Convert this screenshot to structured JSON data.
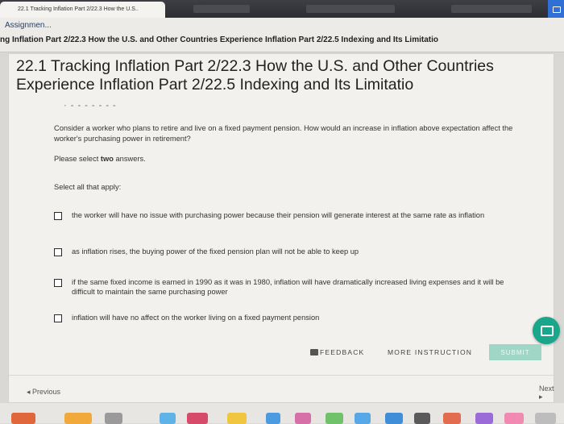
{
  "browser": {
    "tab_title": "22.1 Tracking Inflation Part 2/22.3 How the U.S.."
  },
  "header": {
    "assignment_link": "Assignmen...",
    "breadcrumb": "ng Inflation Part 2/22.3 How the U.S. and Other Countries Experience Inflation Part 2/22.5 Indexing and Its Limitatio"
  },
  "page": {
    "title": "22.1 Tracking Inflation Part 2/22.3 How the U.S. and Other Countries Experience Inflation Part 2/22.5 Indexing and Its Limitatio",
    "dots": "· - - - - - - -"
  },
  "question": {
    "text": "Consider a worker who plans to retire and live on a fixed payment pension. How would an increase in inflation above expectation affect the worker's purchasing power in retirement?",
    "instruction_prefix": "Please select ",
    "instruction_bold": "two",
    "instruction_suffix": " answers.",
    "select_all": "Select all that apply:",
    "options": [
      {
        "label": "the worker will have no issue with purchasing power because their pension will generate interest at the same rate as inflation",
        "checked": false
      },
      {
        "label": "as inflation rises, the buying power of the fixed pension plan will not be able to keep up",
        "checked": false
      },
      {
        "label": "if the same fixed income is earned in 1990 as it was in 1980, inflation will have dramatically increased living expenses and it will be difficult to maintain the same purchasing power",
        "checked": false
      },
      {
        "label": "inflation will have no affect on the worker living on a fixed payment pension",
        "checked": false
      }
    ]
  },
  "actions": {
    "feedback": "FEEDBACK",
    "more_instruction": "MORE INSTRUCTION",
    "submit": "SUBMIT"
  },
  "nav": {
    "previous": "◂ Previous",
    "next": "Next ▸"
  },
  "colors": {
    "accent": "#1aa68a",
    "submit_bg": "#9fd6c5",
    "link": "#1d3f77"
  },
  "icons": [
    "chat-icon",
    "feedback-icon"
  ]
}
